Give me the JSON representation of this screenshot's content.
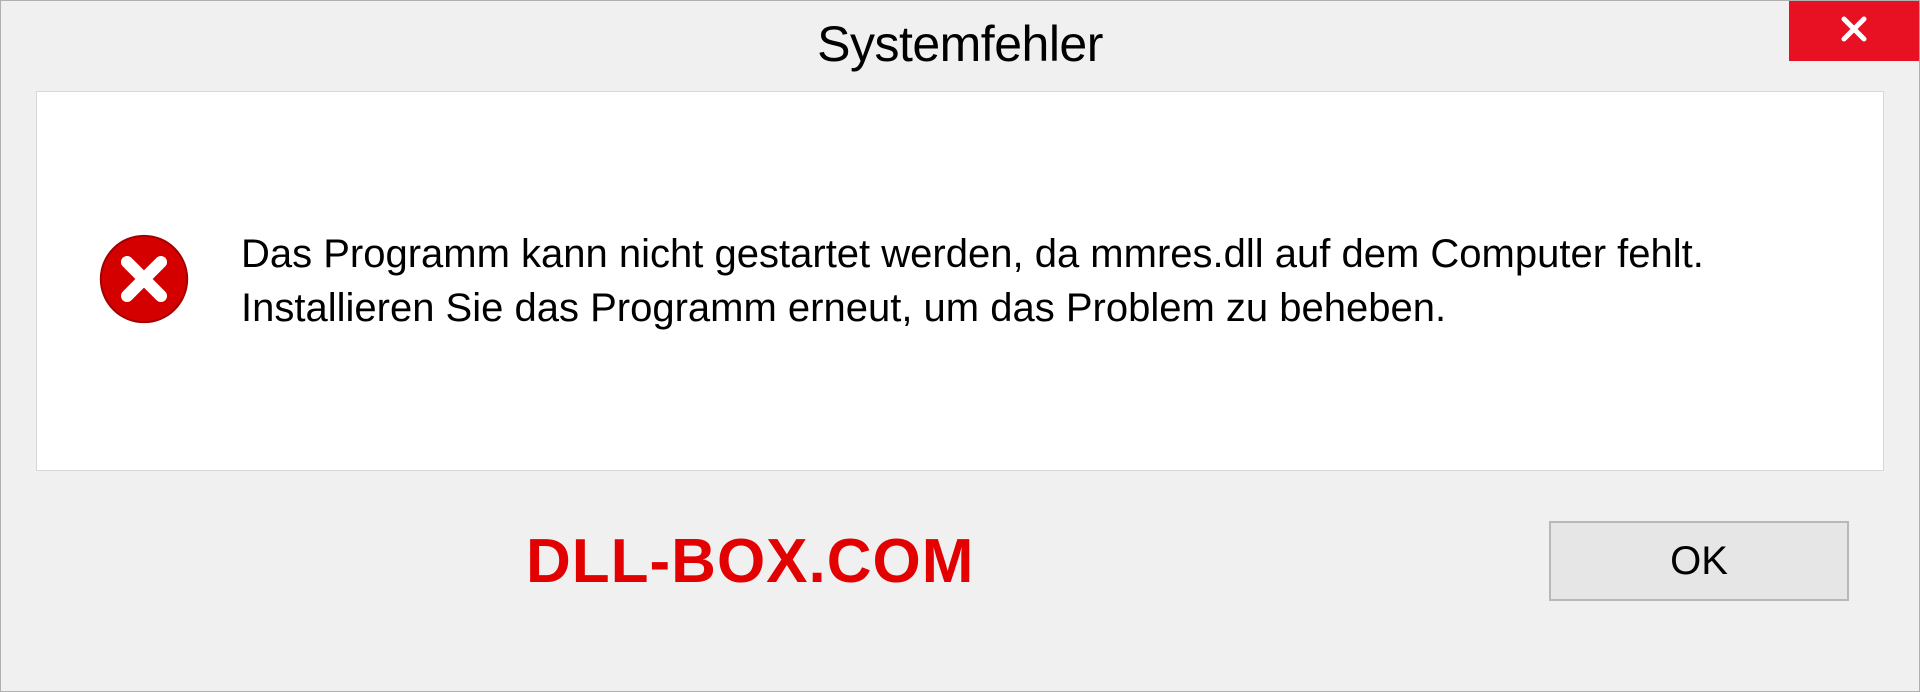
{
  "dialog": {
    "title": "Systemfehler",
    "message": "Das Programm kann nicht gestartet werden, da mmres.dll auf dem Computer fehlt. Installieren Sie das Programm erneut, um das Problem zu beheben.",
    "ok_label": "OK"
  },
  "watermark": {
    "text": "DLL-BOX.COM"
  },
  "colors": {
    "close_button_bg": "#e81123",
    "error_icon_bg": "#d40000",
    "watermark_color": "#e20000"
  }
}
